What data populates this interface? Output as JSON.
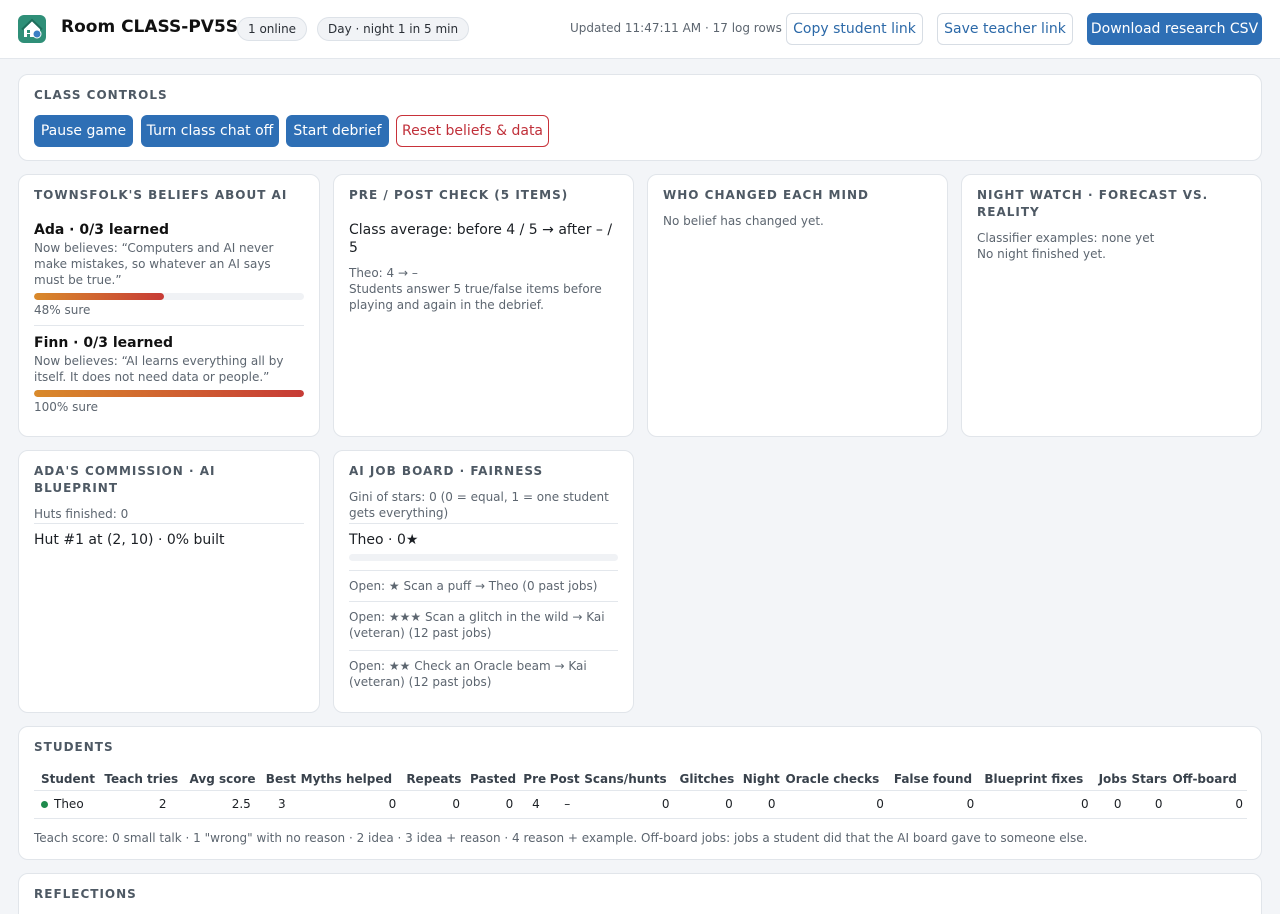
{
  "header": {
    "room_title": "Room CLASS-PV5S",
    "online_badge": "1 online",
    "cycle_badge": "Day · night 1 in 5 min",
    "updated": "Updated 11:47:11 AM · 17 log rows",
    "copy_student_link": "Copy student link",
    "save_teacher_link": "Save teacher link",
    "download_csv": "Download research CSV"
  },
  "class_controls": {
    "title": "CLASS CONTROLS",
    "pause": "Pause game",
    "chat_off": "Turn class chat off",
    "debrief": "Start debrief",
    "reset": "Reset beliefs & data"
  },
  "beliefs": {
    "title": "TOWNSFOLK'S BELIEFS ABOUT AI",
    "people": [
      {
        "name": "Ada · 0/3 learned",
        "belief": "Now believes: “Computers and AI never make mistakes, so whatever an AI says must be true.”",
        "sure_pct": 48,
        "sure_label": "48% sure"
      },
      {
        "name": "Finn · 0/3 learned",
        "belief": "Now believes: “AI learns everything all by itself. It does not need data or people.”",
        "sure_pct": 100,
        "sure_label": "100% sure"
      }
    ]
  },
  "prepost": {
    "title": "PRE / POST CHECK (5 ITEMS)",
    "average": "Class average: before 4 / 5 → after – / 5",
    "student_line": "Theo: 4 → –",
    "note": "Students answer 5 true/false items before playing and again in the debrief."
  },
  "mind_changes": {
    "title": "WHO CHANGED EACH MIND",
    "empty": "No belief has changed yet."
  },
  "night_watch": {
    "title": "NIGHT WATCH · FORECAST VS. REALITY",
    "classifier": "Classifier examples: none yet",
    "status": "No night finished yet."
  },
  "commission": {
    "title": "ADA'S COMMISSION · AI BLUEPRINT",
    "huts_finished": "Huts finished: 0",
    "hut_line": "Hut #1 at (2, 10) · 0% built"
  },
  "job_board": {
    "title": "AI JOB BOARD · FAIRNESS",
    "gini": "Gini of stars: 0 (0 = equal, 1 = one student gets everything)",
    "student_stars": "Theo · 0★",
    "star_fill": 0,
    "open_jobs": [
      "Open: ★ Scan a puff → Theo (0 past jobs)",
      "Open: ★★★ Scan a glitch in the wild → Kai (veteran) (12 past jobs)",
      "Open: ★★ Check an Oracle beam → Kai (veteran) (12 past jobs)"
    ]
  },
  "students": {
    "title": "STUDENTS",
    "columns": [
      "Student",
      "Teach tries",
      "Avg score",
      "Best",
      "Myths helped",
      "Repeats",
      "Pasted",
      "Pre",
      "Post",
      "Scans/hunts",
      "Glitches",
      "Night",
      "Oracle checks",
      "False found",
      "Blueprint fixes",
      "Jobs",
      "Stars",
      "Off-board"
    ],
    "rows": [
      [
        "Theo",
        "2",
        "2.5",
        "3",
        "0",
        "0",
        "0",
        "4",
        "–",
        "0",
        "0",
        "0",
        "0",
        "0",
        "0",
        "0",
        "0",
        "0"
      ]
    ],
    "footnote": "Teach score: 0 small talk · 1 \"wrong\" with no reason · 2 idea · 3 idea + reason · 4 reason + example. Off-board jobs: jobs a student did that the AI board gave to someone else."
  },
  "reflections": {
    "title": "REFLECTIONS"
  },
  "colors": {
    "primary": "#2e6fb5",
    "danger": "#c0303a",
    "online": "#1e8a4c",
    "logo": "#2f8f78"
  }
}
